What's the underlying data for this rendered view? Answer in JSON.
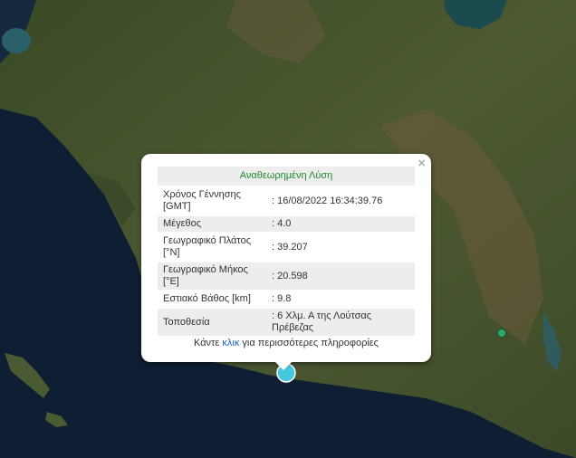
{
  "popup": {
    "title": "Αναθεωρημένη Λύση",
    "close_label": "×",
    "rows": [
      {
        "label": "Χρόνος Γέννησης [GMT]",
        "value": ": 16/08/2022 16:34:39.76"
      },
      {
        "label": "Μέγεθος",
        "value": ": 4.0"
      },
      {
        "label": "Γεωγραφικό Πλάτος [°N]",
        "value": ": 39.207"
      },
      {
        "label": "Γεωγραφικό Μήκος [°E]",
        "value": ": 20.598"
      },
      {
        "label": "Εστιακό Βάθος [km]",
        "value": ": 9.8"
      },
      {
        "label": "Τοποθεσία",
        "value": ": 6 Χλμ. Α της Λούτσας Πρέβεζας"
      }
    ],
    "more_prefix": "Κάντε ",
    "more_link": "κλικ",
    "more_suffix": " για περισσότερες πληροφορίες"
  },
  "markers": {
    "epicenter_color": "#46c8dc",
    "other_color": "#2fa870"
  }
}
